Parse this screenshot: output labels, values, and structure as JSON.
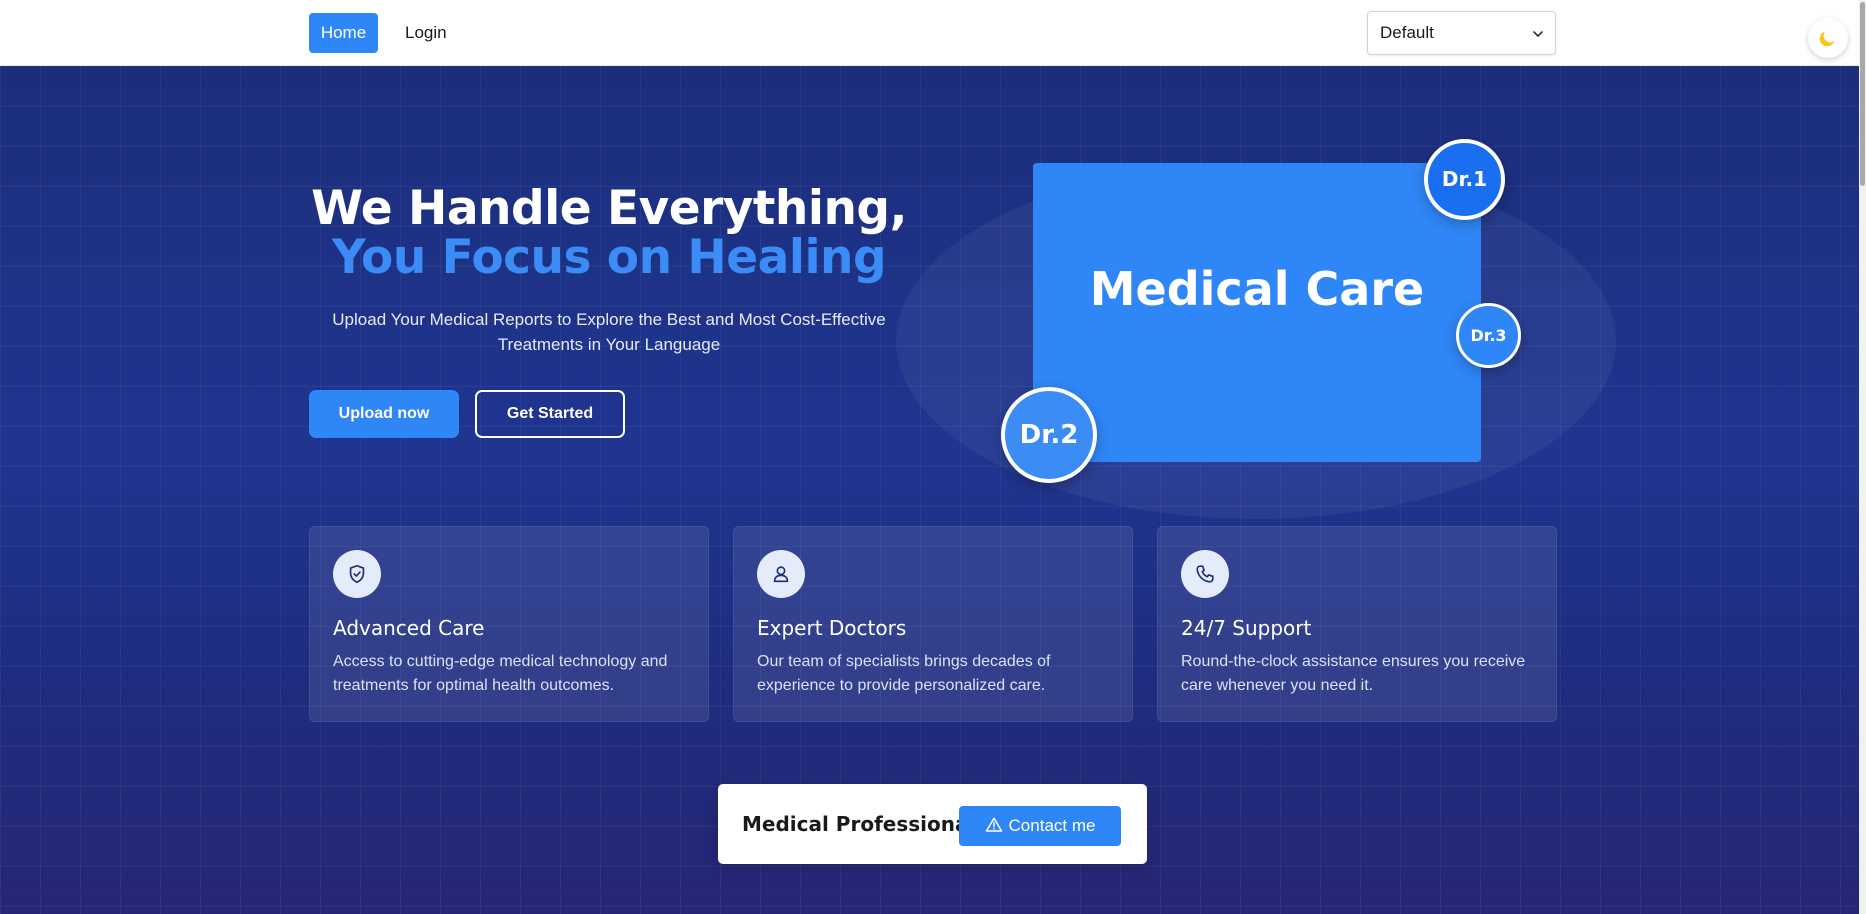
{
  "navbar": {
    "home_label": "Home",
    "login_label": "Login",
    "language_select": {
      "selected": "Default"
    },
    "theme_toggle_icon": "moon-icon"
  },
  "hero": {
    "title_line1": "We Handle Everything,",
    "title_line2": "You Focus on Healing",
    "subtitle": "Upload Your Medical Reports to Explore the Best and Most Cost-Effective Treatments in Your Language",
    "upload_button": "Upload now",
    "start_button": "Get Started",
    "card_title": "Medical Care",
    "doctors": [
      "Dr.1",
      "Dr.2",
      "Dr.3"
    ]
  },
  "features": [
    {
      "icon": "shield-check-icon",
      "title": "Advanced Care",
      "description": "Access to cutting-edge medical technology and treatments for optimal health outcomes."
    },
    {
      "icon": "user-icon",
      "title": "Expert Doctors",
      "description": "Our team of specialists brings decades of experience to provide personalized care."
    },
    {
      "icon": "phone-icon",
      "title": "24/7 Support",
      "description": "Round-the-clock assistance ensures you receive care whenever you need it."
    }
  ],
  "contact": {
    "title": "Medical Professional",
    "button_label": "Contact me",
    "button_icon": "warning-triangle-icon"
  },
  "colors": {
    "accent": "#2f86f6",
    "hero_background": "#1f3590",
    "title_highlight": "#3b8cf7",
    "moon": "#f5c518"
  }
}
